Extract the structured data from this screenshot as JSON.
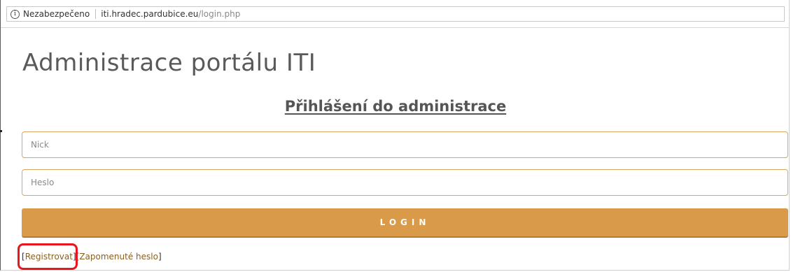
{
  "browser": {
    "security_label": "Nezabezpečeno",
    "url_host": "iti.hradec.pardubice.eu",
    "url_path": "/login.php",
    "info_icon": "info-icon"
  },
  "page": {
    "title": "Administrace portálu ITI",
    "section_heading": "Přihlášení do administrace"
  },
  "form": {
    "nick_placeholder": "Nick",
    "nick_value": "",
    "heslo_placeholder": "Heslo",
    "heslo_value": "",
    "login_label": "LOGIN"
  },
  "links": {
    "open_bracket_1": "[",
    "register_label": "Registrovat",
    "close_open_bracket": "][",
    "forgot_label": "Zapomenuté heslo",
    "close_bracket_2": "]"
  },
  "colors": {
    "accent": "#d99a4a",
    "field_border": "#d9a860",
    "link": "#8a6020",
    "highlight": "#e8141e"
  }
}
